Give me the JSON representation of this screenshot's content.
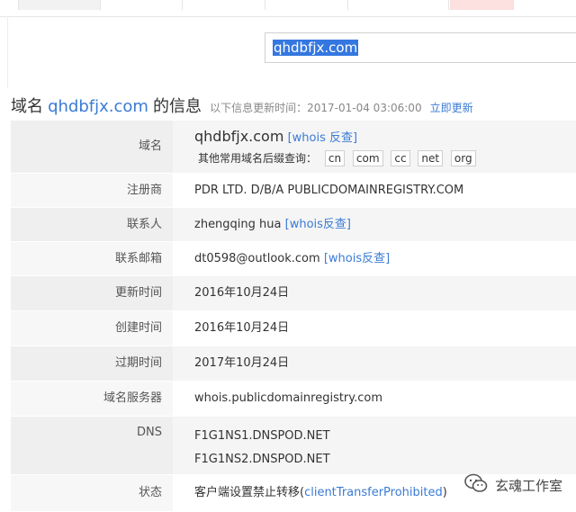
{
  "search": {
    "value": "qhdbfjx.com"
  },
  "heading": {
    "prefix": "域名",
    "domain": "qhdbfjx.com",
    "suffix": "的信息",
    "updated_note": "以下信息更新时间：2017-01-04 03:06:00",
    "refresh_link": "立即更新"
  },
  "rows": {
    "domain": {
      "label": "域名",
      "value": "qhdbfjx.com",
      "whois_link": "[whois 反查]",
      "suffix_prompt": "其他常用域名后缀查询：",
      "suffixes": [
        "cn",
        "com",
        "cc",
        "net",
        "org"
      ]
    },
    "registrar": {
      "label": "注册商",
      "value": "PDR LTD. D/B/A PUBLICDOMAINREGISTRY.COM"
    },
    "contact": {
      "label": "联系人",
      "value": "zhengqing hua",
      "whois_link": "[whois反查]"
    },
    "email": {
      "label": "联系邮箱",
      "value": "dt0598@outlook.com",
      "whois_link": "[whois反查]"
    },
    "updated": {
      "label": "更新时间",
      "value": "2016年10月24日"
    },
    "created": {
      "label": "创建时间",
      "value": "2016年10月24日"
    },
    "expires": {
      "label": "过期时间",
      "value": "2017年10月24日"
    },
    "nameserver": {
      "label": "域名服务器",
      "value": "whois.publicdomainregistry.com"
    },
    "dns": {
      "label": "DNS",
      "values": [
        "F1G1NS1.DNSPOD.NET",
        "F1G1NS2.DNSPOD.NET"
      ]
    },
    "status": {
      "label": "状态",
      "prefix": "客户端设置禁止转移(",
      "code": "clientTransferProhibited",
      "suffix": ")"
    }
  },
  "watermark": {
    "text": "玄魂工作室",
    "icon": "wechat-icon"
  },
  "colors": {
    "link": "#3a7bd5",
    "selection": "#3477e0"
  }
}
